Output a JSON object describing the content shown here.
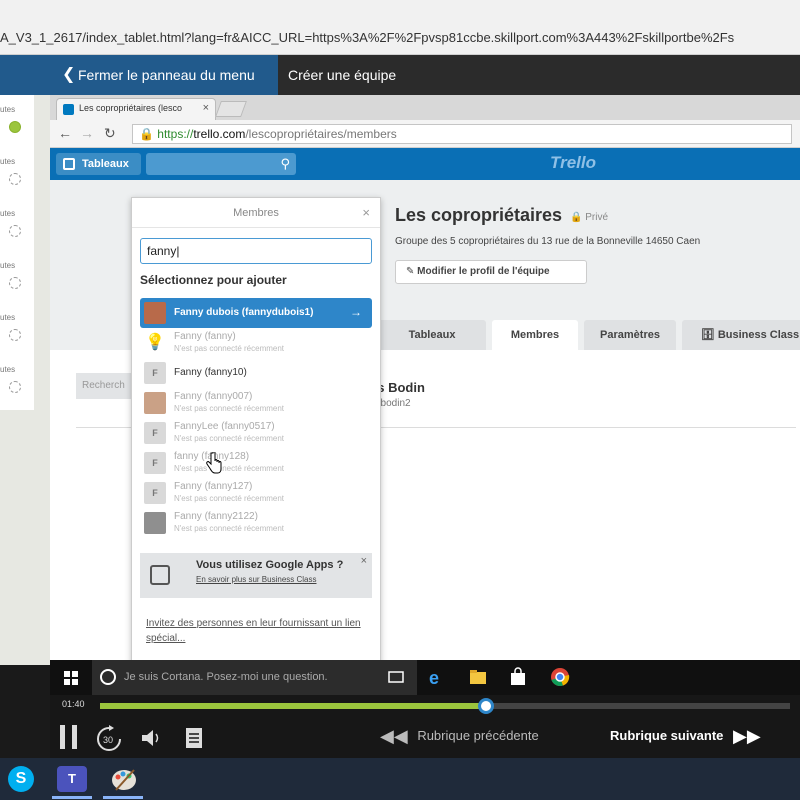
{
  "outer_browser": {
    "url": "A_V3_1_2617/index_tablet.html?lang=fr&AICC_URL=https%3A%2F%2Fpvsp81ccbe.skillport.com%3A443%2Fskillportbe%2Fs"
  },
  "course_header": {
    "close_panel_label": "Fermer le panneau du menu",
    "current_topic": "Créer une équipe"
  },
  "left_modules": [
    {
      "label": "utes",
      "done": true
    },
    {
      "label": "utes",
      "done": false
    },
    {
      "label": "utes",
      "done": false
    },
    {
      "label": "utes",
      "done": false
    },
    {
      "label": "utes",
      "done": false
    },
    {
      "label": "utes",
      "done": false
    }
  ],
  "inner_browser": {
    "tab_title": "Les copropriétaires (lesco",
    "url_scheme": "https://",
    "url_host": "trello.com",
    "url_path": "/lescopropriétaires/members"
  },
  "trello": {
    "boards_label": "Tableaux",
    "logo": "Trello",
    "team_name": "Les copropriétaires",
    "privacy": "Privé",
    "team_description": "Groupe des 5 copropriétaires du 13 rue de la Bonneville 14650 Caen",
    "edit_profile_label": "Modifier le profil de l'équipe",
    "tabs": [
      {
        "label": "Tableaux",
        "active": false
      },
      {
        "label": "Membres",
        "active": true
      },
      {
        "label": "Paramètres",
        "active": false
      },
      {
        "label": "Business Class",
        "active": false
      }
    ],
    "member_search_placeholder": "Recherch",
    "member_name": "as Bodin",
    "member_username": "asbodin2"
  },
  "popup": {
    "title": "Membres",
    "search_value": "fanny|",
    "section_title": "Sélectionnez pour ajouter",
    "results": [
      {
        "name": "Fanny dubois (fannydubois1)",
        "status": "",
        "avatar": "photo1",
        "selected": true,
        "active": true
      },
      {
        "name": "Fanny (fanny)",
        "status": "N'est pas connecté récemment",
        "avatar": "bulb",
        "selected": false,
        "active": false
      },
      {
        "name": "Fanny (fanny10)",
        "status": "",
        "avatar": "F",
        "selected": false,
        "active": true
      },
      {
        "name": "Fanny (fanny007)",
        "status": "N'est pas connecté récemment",
        "avatar": "photo2",
        "selected": false,
        "active": false
      },
      {
        "name": "FannyLee (fanny0517)",
        "status": "N'est pas connecté récemment",
        "avatar": "F",
        "selected": false,
        "active": false
      },
      {
        "name": "fanny (fanny128)",
        "status": "N'est pas connecté récemment",
        "avatar": "F",
        "selected": false,
        "active": false
      },
      {
        "name": "Fanny (fanny127)",
        "status": "N'est pas connecté récemment",
        "avatar": "F",
        "selected": false,
        "active": false
      },
      {
        "name": "Fanny (fanny2122)",
        "status": "N'est pas connecté récemment",
        "avatar": "photo3",
        "selected": false,
        "active": false
      }
    ],
    "gapps_title": "Vous utilisez Google Apps ?",
    "gapps_link": "En savoir plus sur Business Class",
    "invite_text": "Invitez des personnes en leur fournissant un lien spécial..."
  },
  "taskbar": {
    "cortana_placeholder": "Je suis Cortana. Posez-moi une question."
  },
  "player": {
    "time": "01:40",
    "progress": 0.56,
    "prev_label": "Rubrique précédente",
    "next_label": "Rubrique suivante",
    "replay_label": "30"
  },
  "colors": {
    "trello_blue": "#0a6fb5",
    "selected_blue": "#2e86c9",
    "progress_green": "#9bc53d"
  }
}
